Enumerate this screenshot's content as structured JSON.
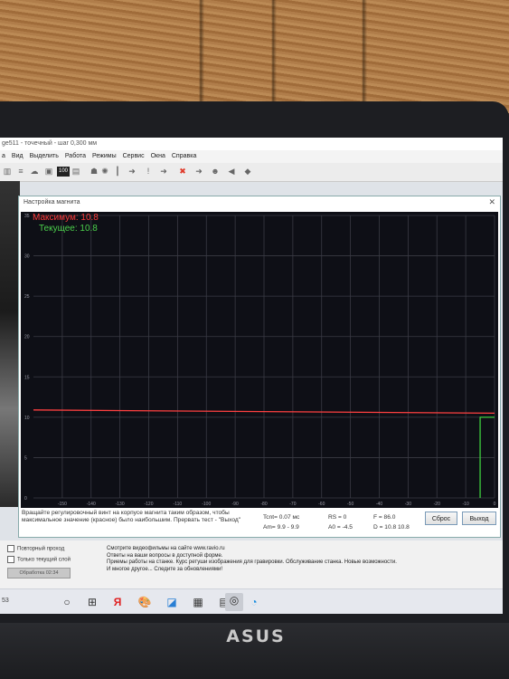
{
  "window": {
    "title": "ge511 - точечный - шаг 0,300 мм",
    "menu": [
      "а",
      "Вид",
      "Выделить",
      "Работа",
      "Режимы",
      "Сервис",
      "Окна",
      "Справка"
    ]
  },
  "toolbar_icons": [
    "columns-icon",
    "lines-icon",
    "cloud-icon",
    "image-icon",
    "grid-100-icon",
    "book-icon",
    "figure-icon",
    "sun-icon",
    "ruler-icon",
    "down-arrow-icon",
    "exclamation-icon",
    "right-arrow-icon",
    "x-icon",
    "right-arrow-icon",
    "people-icon",
    "speaker-icon",
    "diamond-icon"
  ],
  "dialog": {
    "title": "Настройка магнита",
    "max_label": "Максимум: 10.8",
    "current_label": "Текущее: 10.8",
    "hint": "Вращайте регулировочный винт на корпусе магнита таким образом, чтобы максимальное значение (красное) было наибольшим. Прервать тест - \"Выход\"",
    "stats": {
      "tcnt": "Tcnt=  0.07  мс",
      "am": "Am=  9.9 - 9.9",
      "rs": "RS =   0",
      "a0": "A0 =  -4.5",
      "f": "F =  86.0",
      "d": "D = 10.8 10.8"
    },
    "reset_button": "Сброс",
    "exit_button": "Выход"
  },
  "chart_data": {
    "type": "line",
    "xlim": [
      -160,
      0
    ],
    "ylim": [
      0,
      35
    ],
    "x_ticks": [
      -150,
      -140,
      -130,
      -120,
      -110,
      -100,
      -90,
      -80,
      -70,
      -60,
      -50,
      -40,
      -30,
      -20,
      -10,
      0
    ],
    "y_ticks": [
      0,
      5,
      10,
      15,
      20,
      25,
      30,
      35
    ],
    "grid": true,
    "series": [
      {
        "color": "#ff4040",
        "x": [
          -160,
          0
        ],
        "values": [
          10.9,
          10.5
        ]
      },
      {
        "color": "#3ecf3e",
        "x": [
          -5,
          -5,
          0
        ],
        "values": [
          0,
          10.0,
          10.0
        ]
      }
    ]
  },
  "bottom_panel": {
    "repeat_pass": "Повторный проход",
    "current_layer_only": "Только текущий слой",
    "action_button": "Обработка 02:34",
    "info_lines": [
      "Смотрите видеофильмы на сайте www.ravio.ru",
      "Ответы на ваши вопросы в доступной форме.",
      "Приемы работы на станке. Курс ретуши изображения для гравировки. Обслуживание станка. Новые возможности.",
      "И многое другое... Следите за обновлениями!"
    ]
  },
  "taskbar": {
    "left_text": "53",
    "icons": [
      "windows-start-icon",
      "task-view-icon",
      "yandex-icon",
      "paint-icon",
      "store-icon",
      "photos-icon",
      "calculator-icon",
      "app-swirl-icon",
      "edge-icon"
    ]
  },
  "laptop_brand": "ASUS",
  "colors": {
    "graph_bg": "#0e0f16",
    "max_color": "#ff3b3b",
    "current_color": "#4cd14c",
    "grid": "#3a3b45"
  }
}
